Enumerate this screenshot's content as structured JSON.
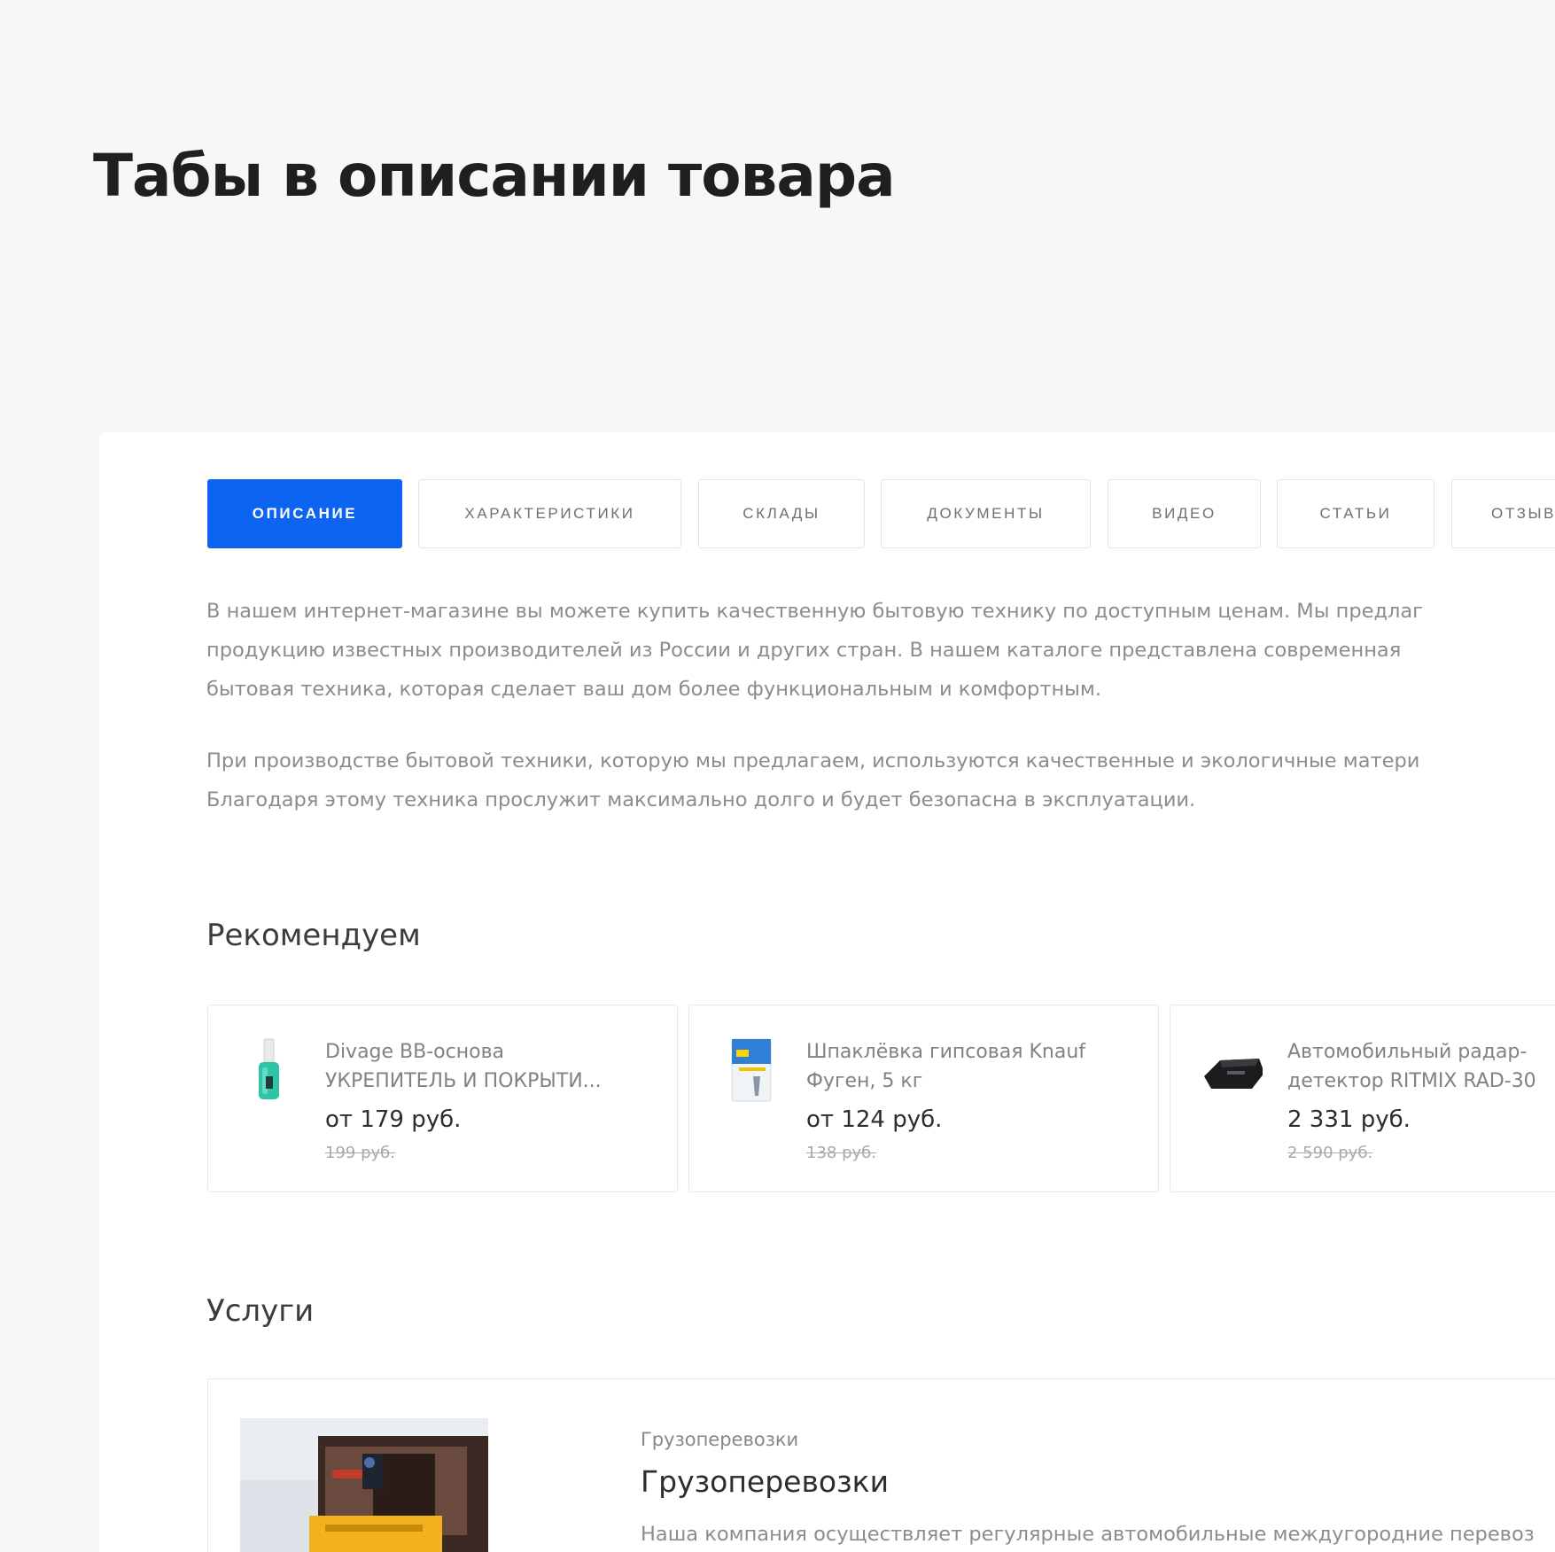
{
  "page": {
    "title": "Табы в описании товара"
  },
  "tabs": [
    {
      "label": "ОПИСАНИЕ",
      "active": true
    },
    {
      "label": "ХАРАКТЕРИСТИКИ",
      "active": false
    },
    {
      "label": "СКЛАДЫ",
      "active": false
    },
    {
      "label": "ДОКУМЕНТЫ",
      "active": false
    },
    {
      "label": "ВИДЕО",
      "active": false
    },
    {
      "label": "СТАТЬИ",
      "active": false
    },
    {
      "label": "ОТЗЫВ",
      "active": false
    }
  ],
  "description": {
    "paragraphs": [
      {
        "lines": [
          "В нашем интернет-магазине вы можете купить качественную бытовую технику по доступным ценам. Мы предлаг",
          "продукцию известных производителей из России и других стран. В нашем каталоге представлена современная",
          "бытовая техника, которая сделает ваш дом более функциональным и комфортным."
        ]
      },
      {
        "lines": [
          "При производстве бытовой техники, которую мы предлагаем, используются качественные и экологичные матери",
          "Благодаря этому техника прослужит максимально долго и будет безопасна в эксплуатации."
        ]
      }
    ]
  },
  "recommend": {
    "title": "Рекомендуем",
    "items": [
      {
        "name_line1": "Divage BB-основа",
        "name_line2": "УКРЕПИТЕЛЬ И ПОКРЫТИ...",
        "price": "от 179 руб.",
        "old_price": "199 руб.",
        "icon": "nail-polish-icon"
      },
      {
        "name_line1": "Шпаклёвка гипсовая Knauf",
        "name_line2": "Фуген, 5 кг",
        "price": "от 124 руб.",
        "old_price": "138 руб.",
        "icon": "putty-bag-icon"
      },
      {
        "name_line1": "Автомобильный радар-",
        "name_line2": "детектор RITMIX RAD-30",
        "price": "2 331 руб.",
        "old_price": "2 590 руб.",
        "icon": "radar-detector-icon"
      }
    ]
  },
  "services": {
    "title": "Услуги",
    "item": {
      "category": "Грузоперевозки",
      "title": "Грузоперевозки",
      "text": "Наша компания осуществляет регулярные автомобильные междугородние перевоз",
      "image": "forklift-truck-photo"
    }
  },
  "colors": {
    "accent": "#0c64f0",
    "background": "#f6f7f9",
    "card": "#ffffff"
  }
}
